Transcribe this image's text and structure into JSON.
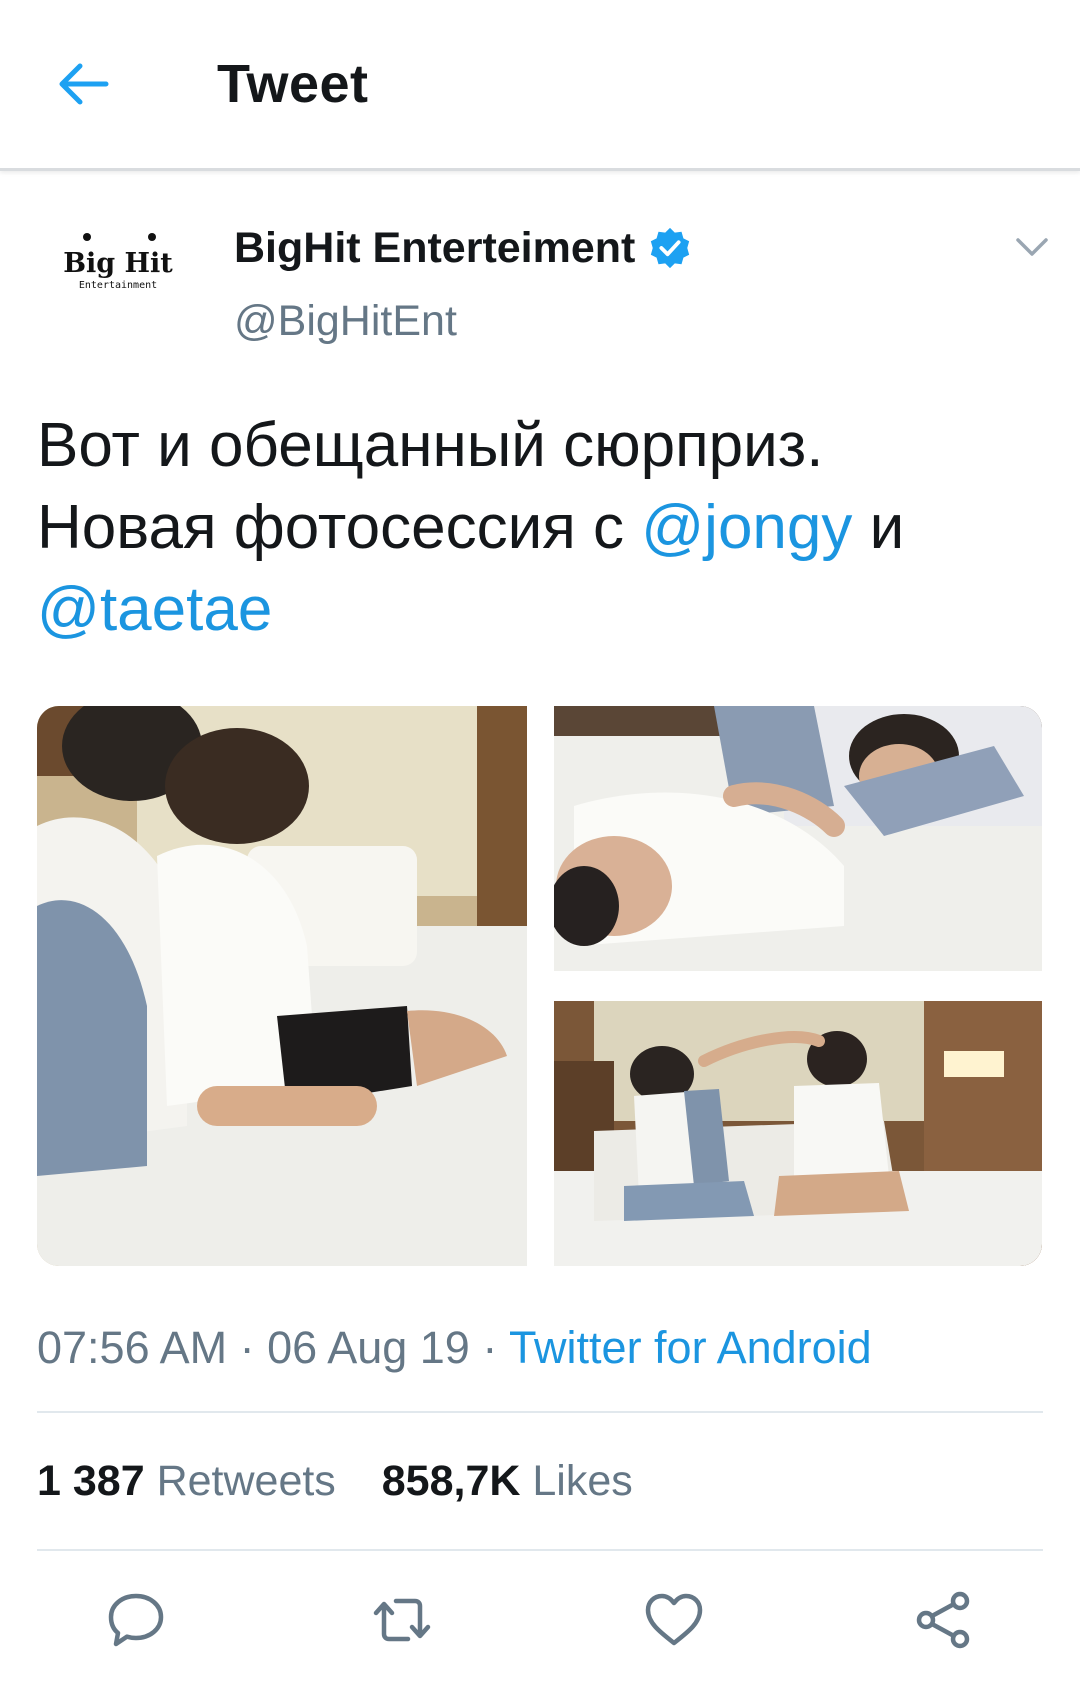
{
  "header": {
    "title": "Tweet",
    "back_icon": "arrow-left-icon"
  },
  "author": {
    "avatar_brand_text": "Big Hit",
    "avatar_brand_subtext": "Entertainment",
    "name": "BigHit Enterteiment",
    "verified": true,
    "handle": "@BigHitEnt"
  },
  "tweet": {
    "line1": "Вот и обещанный сюрприз.",
    "line2_prefix": "Новая фотосессия с ",
    "mention1": "@jongy",
    "line2_suffix": " и",
    "mention2": "@taetae"
  },
  "media": {
    "count": 3
  },
  "meta": {
    "time": "07:56 AM",
    "sep1": " · ",
    "date": "06 Aug 19",
    "sep2": " · ",
    "source": "Twitter for Android"
  },
  "stats": {
    "retweets_count": "1 387",
    "retweets_label": "Retweets",
    "likes_count": "858,7K",
    "likes_label": "Likes"
  },
  "colors": {
    "accent": "#1b95e0",
    "text": "#14171a",
    "muted": "#657786",
    "divider": "#e1e8ed"
  }
}
